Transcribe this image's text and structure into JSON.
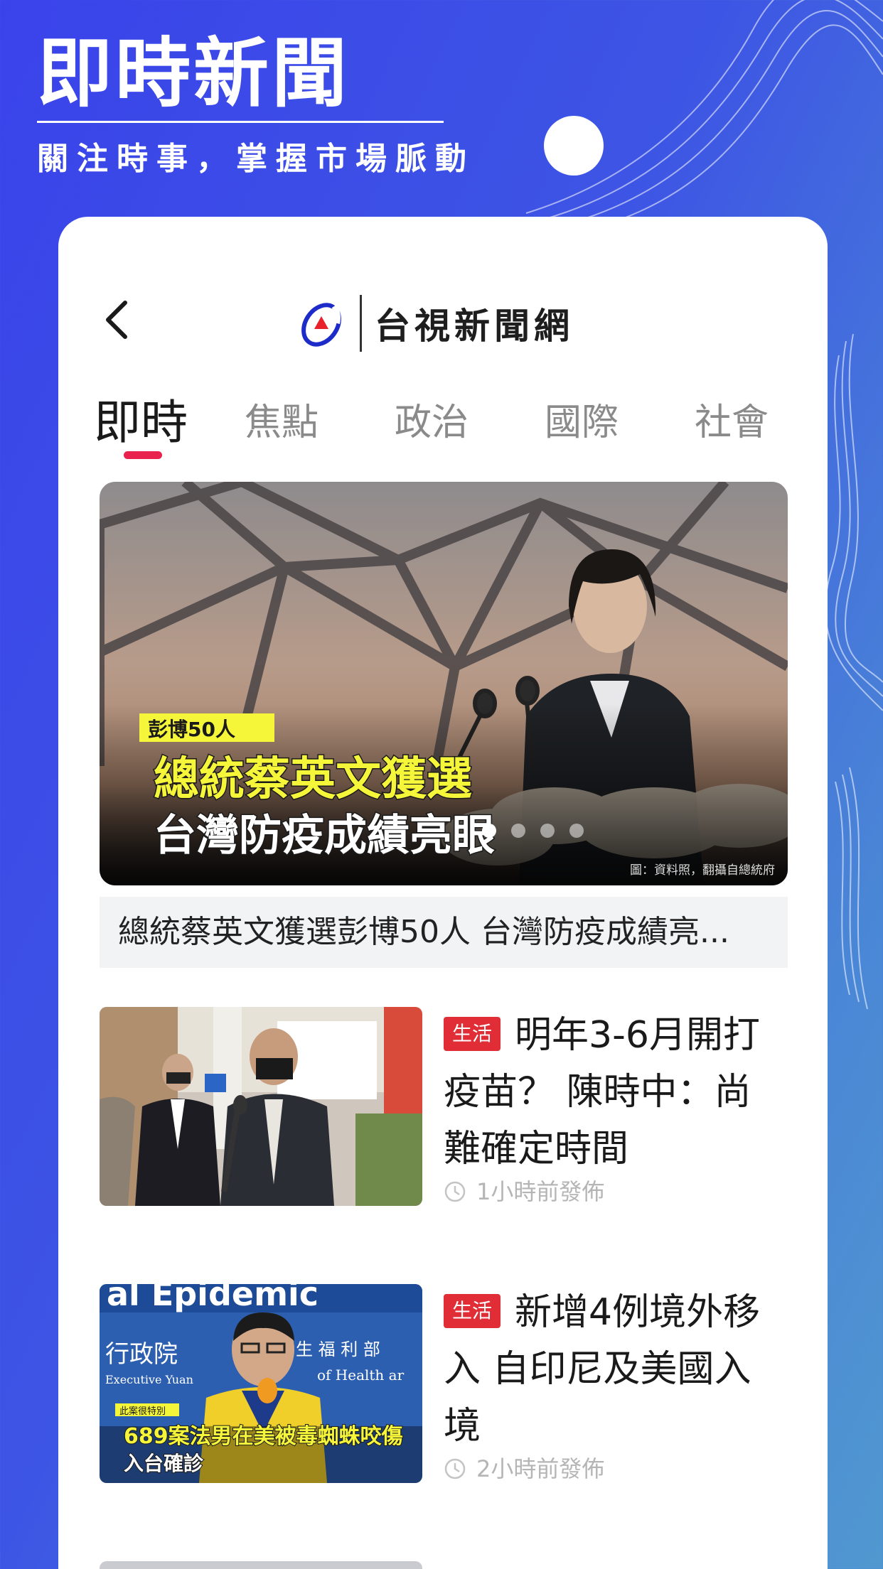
{
  "promo": {
    "title": "即時新聞",
    "subtitle": "關注時事，掌握市場脈動"
  },
  "header": {
    "back_icon": "chevron-left-icon",
    "logo_icon": "tts-logo-icon",
    "brand_name": "台視新聞網"
  },
  "tabs": [
    {
      "label": "即時",
      "active": true
    },
    {
      "label": "焦點",
      "active": false
    },
    {
      "label": "政治",
      "active": false
    },
    {
      "label": "國際",
      "active": false
    },
    {
      "label": "社會",
      "active": false
    }
  ],
  "hero": {
    "overlay_tag": "彭博50人",
    "overlay_line1": "總統蔡英文獲選",
    "overlay_line2": "台灣防疫成績亮眼",
    "credit": "圖：資料照，翻攝自總統府",
    "caption": "總統蔡英文獲選彭博50人 台灣防疫成績亮...",
    "carousel_total": 4,
    "carousel_active": 1
  },
  "news": [
    {
      "category": "生活",
      "headline": "明年3-6月開打疫苗？ 陳時中：尚難確定時間",
      "time": "1小時前發佈",
      "thumb_text": {}
    },
    {
      "category": "生活",
      "headline": "新增4例境外移入 自印尼及美國入境",
      "time": "2小時前發佈",
      "thumb_text": {
        "banner": "al Epidemic",
        "ministry": "生 福 利 部",
        "ministry_en": "of Health ar",
        "yuan": "行政院",
        "yuan_en": "Executive Yuan",
        "tag": "此案很特別",
        "line1": "689案法男在美被毒蜘蛛咬傷",
        "line2": "入台確診"
      }
    }
  ],
  "colors": {
    "background_blue": "#3a43ea",
    "accent_red": "#e8214d",
    "badge_red": "#e02d36",
    "highlight_yellow": "#f5f53a"
  }
}
